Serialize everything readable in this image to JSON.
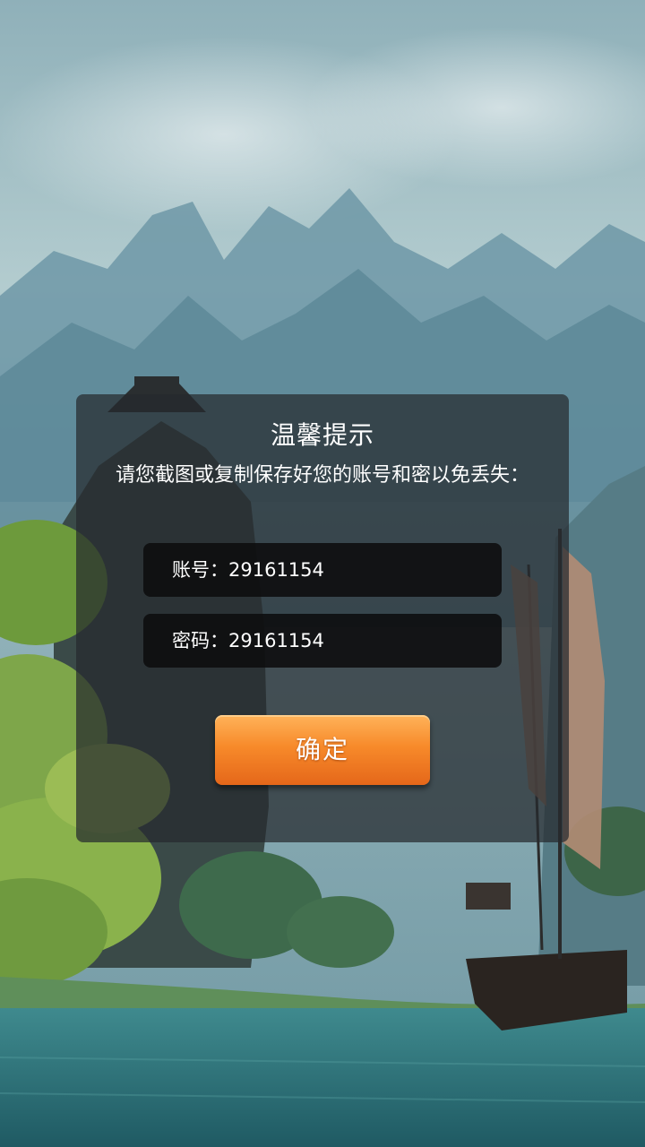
{
  "dialog": {
    "title": "温馨提示",
    "message": "请您截图或复制保存好您的账号和密以免丢失：",
    "account_label": "账号：",
    "account_value": "29161154",
    "password_label": "密码：",
    "password_value": "29161154",
    "confirm_label": "确定"
  },
  "colors": {
    "confirm_button": "#f78a2a",
    "dialog_background": "#262a2e",
    "field_background": "#0c0c0e"
  }
}
